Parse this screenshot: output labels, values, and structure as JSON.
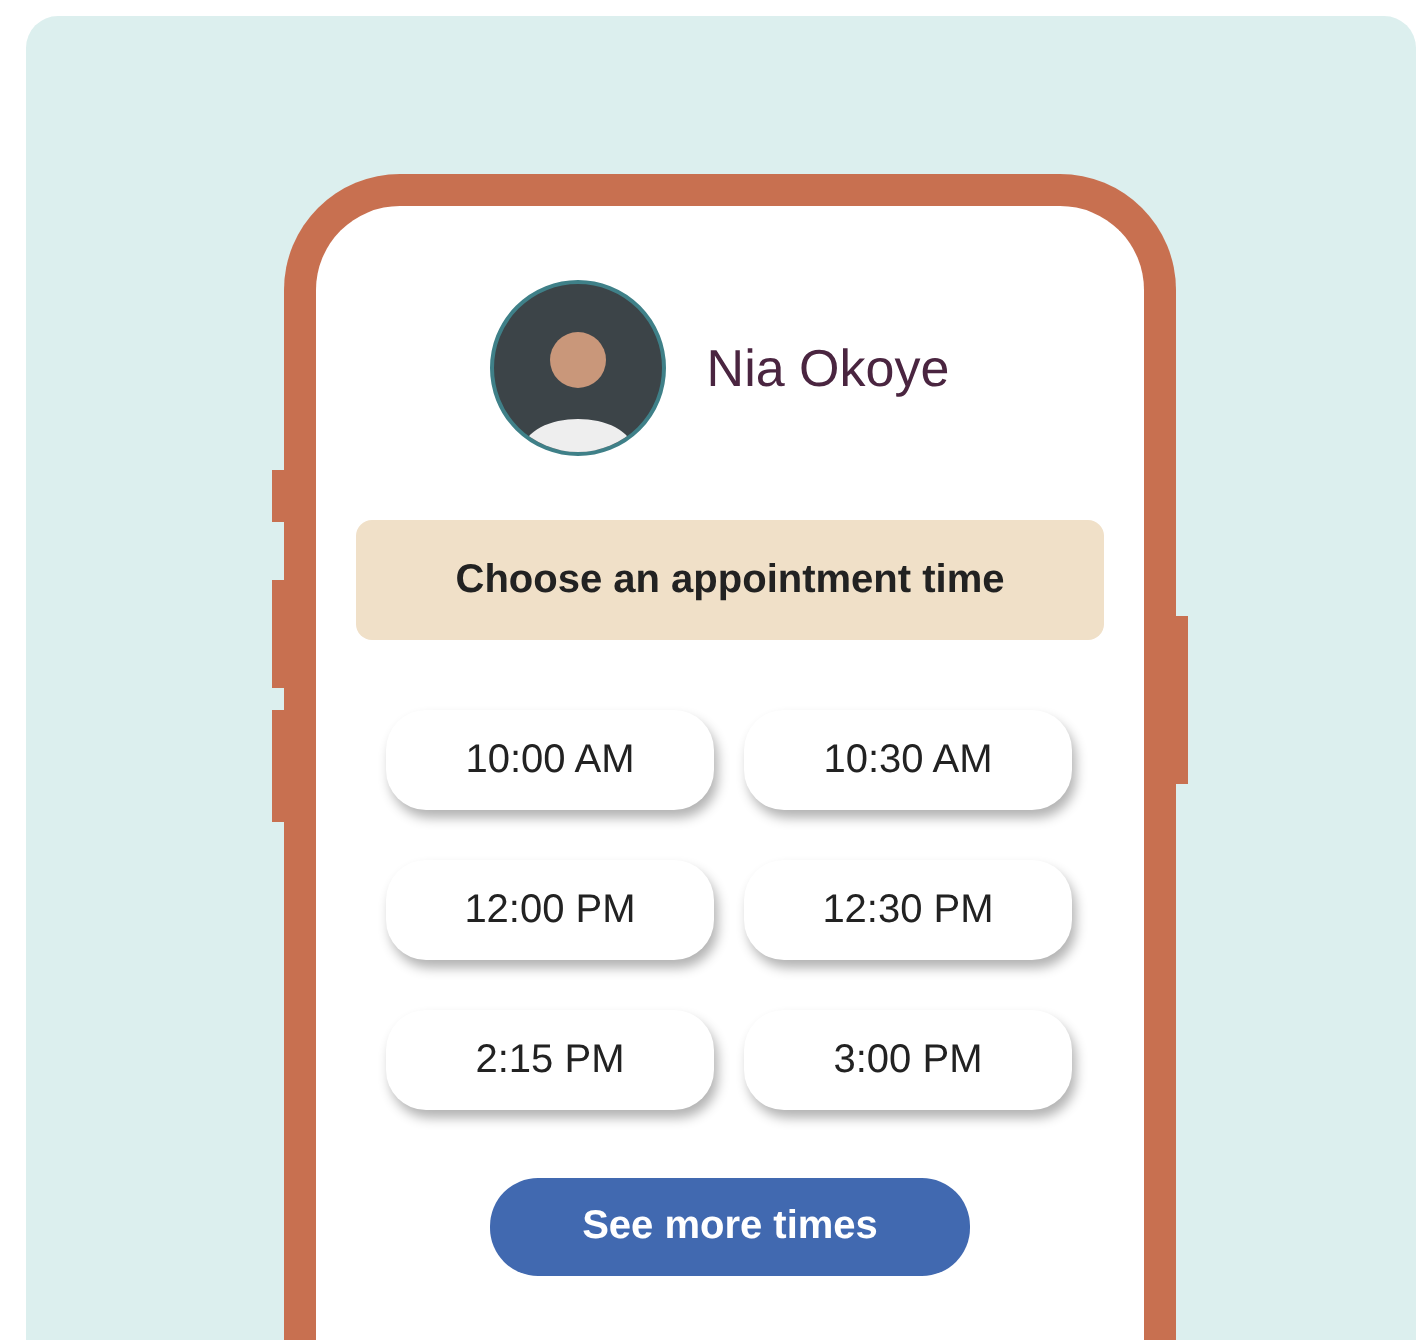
{
  "profile": {
    "name": "Nia Okoye"
  },
  "banner": {
    "title": "Choose an appointment time"
  },
  "time_slots": [
    {
      "label": "10:00 AM",
      "selected": false
    },
    {
      "label": "10:30 AM",
      "selected": false
    },
    {
      "label": "12:00 PM",
      "selected": false
    },
    {
      "label": "12:30 PM",
      "selected": false
    },
    {
      "label": "2:15 PM",
      "selected": false
    },
    {
      "label": "3:00 PM",
      "selected": false
    }
  ],
  "more_button": {
    "label": "See more times"
  }
}
